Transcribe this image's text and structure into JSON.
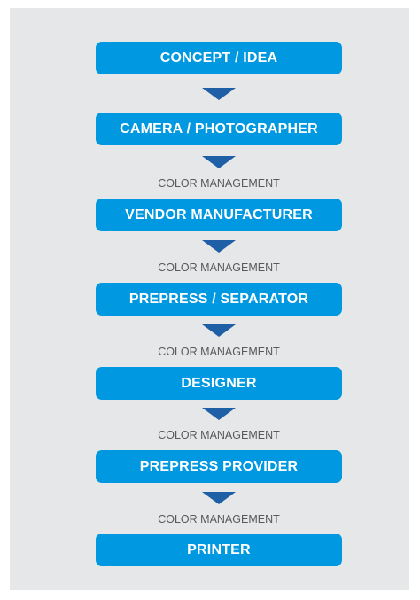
{
  "flow": {
    "steps": [
      "CONCEPT / IDEA",
      "CAMERA / PHOTOGRAPHER",
      "VENDOR MANUFACTURER",
      "PREPRESS / SEPARATOR",
      "DESIGNER",
      "PREPRESS PROVIDER",
      "PRINTER"
    ],
    "connector_label": "COLOR MANAGEMENT"
  },
  "colors": {
    "box": "#0098e0",
    "arrow": "#1f5fa6",
    "panel": "#e6e7e8",
    "label": "#58595b"
  }
}
